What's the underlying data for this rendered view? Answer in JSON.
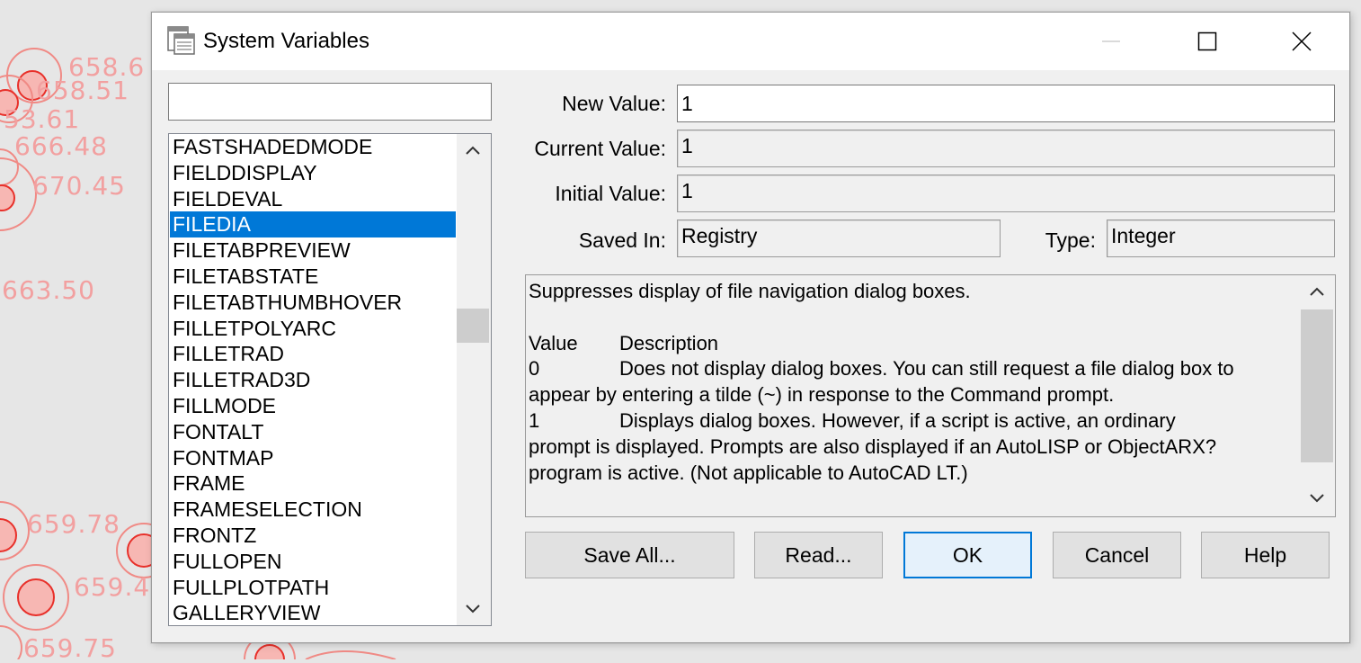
{
  "background": {
    "labels": [
      "658.6",
      "658.51",
      "53.61",
      "666.48",
      "670.45",
      "663.50",
      "659.78",
      "659.4",
      "659.75"
    ],
    "accent_color": "#e8302a"
  },
  "window": {
    "title": "System Variables",
    "icon": "system-variables-icon"
  },
  "search": {
    "value": ""
  },
  "variables": {
    "items": [
      "FASTSHADEDMODE",
      "FIELDDISPLAY",
      "FIELDEVAL",
      "FILEDIA",
      "FILETABPREVIEW",
      "FILETABSTATE",
      "FILETABTHUMBHOVER",
      "FILLETPOLYARC",
      "FILLETRAD",
      "FILLETRAD3D",
      "FILLMODE",
      "FONTALT",
      "FONTMAP",
      "FRAME",
      "FRAMESELECTION",
      "FRONTZ",
      "FULLOPEN",
      "FULLPLOTPATH",
      "GALLERYVIEW"
    ],
    "selected": "FILEDIA"
  },
  "fields": {
    "new_value_label": "New Value:",
    "new_value": "1",
    "current_value_label": "Current Value:",
    "current_value": "1",
    "initial_value_label": "Initial Value:",
    "initial_value": "1",
    "saved_in_label": "Saved In:",
    "saved_in": "Registry",
    "type_label": "Type:",
    "type": "Integer"
  },
  "description": {
    "summary": "Suppresses display of file navigation dialog boxes.",
    "header_value": "Value",
    "header_description": "Description",
    "row0_value": "0",
    "row0_text": "Does not display dialog boxes. You can still request a file dialog box to",
    "row0_cont": "appear by entering a tilde (~) in response to the Command prompt.",
    "row1_value": "1",
    "row1_text": "Displays dialog boxes. However, if a script is active, an ordinary",
    "row1_cont1": "prompt is displayed.  Prompts are also displayed if an AutoLISP or ObjectARX?",
    "row1_cont2": "program is active. (Not applicable to AutoCAD LT.)"
  },
  "buttons": {
    "save_all": "Save All...",
    "read": "Read...",
    "ok": "OK",
    "cancel": "Cancel",
    "help": "Help"
  },
  "colors": {
    "selection": "#0078d7",
    "default_button_border": "#0078d7"
  }
}
